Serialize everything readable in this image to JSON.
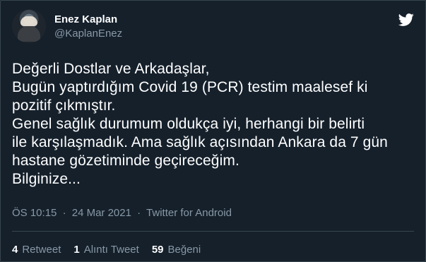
{
  "tweet": {
    "display_name": "Enez Kaplan",
    "handle": "@KaplanEnez",
    "text": "Değerli Dostlar ve Arkadaşlar,\nBugün yaptırdığım Covid 19 (PCR) testim maalesef ki\npozitif çıkmıştır.\nGenel sağlık durumum oldukça iyi, herhangi bir belirti\nile karşılaşmadık. Ama sağlık açısından Ankara da 7 gün\nhastane gözetiminde geçireceğim.\nBilginize...",
    "time": "ÖS 10:15",
    "date": "24 Mar 2021",
    "separator": "·",
    "source": "Twitter for Android"
  },
  "stats": {
    "retweets_count": "4",
    "retweets_label": "Retweet",
    "quotes_count": "1",
    "quotes_label": "Alıntı Tweet",
    "likes_count": "59",
    "likes_label": "Beğeni"
  },
  "icons": {
    "logo": "twitter-bird-icon"
  },
  "colors": {
    "background": "#15202b",
    "text": "#ffffff",
    "secondary_text": "#8899a6",
    "border": "#38444d"
  }
}
